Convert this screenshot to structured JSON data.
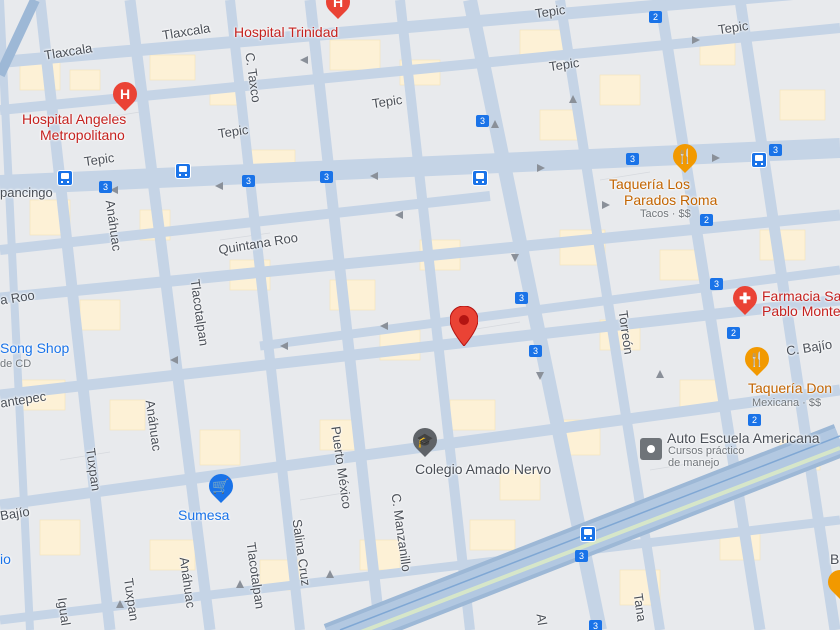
{
  "streets": {
    "tepic_1": "Tepic",
    "tepic_2": "Tepic",
    "tepic_3": "Tepic",
    "tepic_4": "Tepic",
    "tepic_5": "Tepic",
    "tepic_6": "Tepic",
    "tlaxcala_1": "Tlaxcala",
    "tlaxcala_2": "Tlaxcala",
    "c_taxco": "C. Taxco",
    "quintana_roo_1": "Quintana Roo",
    "quintana_roo_2": "a Roo",
    "anahuac_1": "Anáhuac",
    "anahuac_2": "Anáhuac",
    "anahuac_3": "Anáhuac",
    "tlacotalpan_1": "Tlacotalpan",
    "tlacotalpan_2": "Tlacotalpan",
    "tuxpan_1": "Tuxpan",
    "tuxpan_2": "Tuxpan",
    "puerto_mexico": "Puerto México",
    "c_manzanillo": "C. Manzanillo",
    "salina_cruz": "Salina Cruz",
    "torreon": "Torreón",
    "c_bajio_1": "C. Bajío",
    "c_bajio_2": "Bajío",
    "chapancingo": "pancingo",
    "antepec": "antepec",
    "iguala": "Igual",
    "tana": "Tana",
    "al": "Al"
  },
  "pois": {
    "hospital_trinidad": "Hospital Trinidad",
    "hospital_angeles_1": "Hospital Angeles",
    "hospital_angeles_2": "Metropolitano",
    "taqueria_parados_1": "Taquería Los",
    "taqueria_parados_2": "Parados Roma",
    "taqueria_parados_sub": "Tacos · $$",
    "farmacia_1": "Farmacia Sa",
    "farmacia_2": "Pablo Monte",
    "taqueria_don": "Taquería Don",
    "taqueria_don_sub": "Mexicana · $$",
    "auto_escuela": "Auto Escuela Americana",
    "auto_escuela_sub_1": "Cursos práctico",
    "auto_escuela_sub_2": "de manejo",
    "colegio": "Colegio Amado Nervo",
    "sumesa": "Sumesa",
    "song_shop": "Song Shop",
    "song_shop_sub": "de CD",
    "edge_b": "B",
    "edge_io": "io"
  },
  "route_shields": {
    "s1": "3",
    "s2": "3",
    "s3": "3",
    "s4": "3",
    "s5": "3",
    "s6": "3",
    "s7": "3",
    "s8": "3",
    "s9": "3",
    "s10": "3",
    "s11": "2",
    "s12": "2",
    "s13": "2",
    "s14": "2",
    "s15": "3"
  },
  "icons": {
    "pin": "location-pin-icon",
    "hospital": "hospital-icon",
    "restaurant": "restaurant-icon",
    "pharmacy": "pharmacy-icon",
    "school": "school-icon",
    "shopping": "shopping-cart-icon",
    "business": "business-icon",
    "bus": "bus-stop-icon"
  },
  "colors": {
    "pin": "#ea4335",
    "hospital": "#ea4335",
    "restaurant": "#f29900",
    "school": "#5f6368",
    "shopping": "#1a73e8",
    "transit": "#1a73e8"
  }
}
